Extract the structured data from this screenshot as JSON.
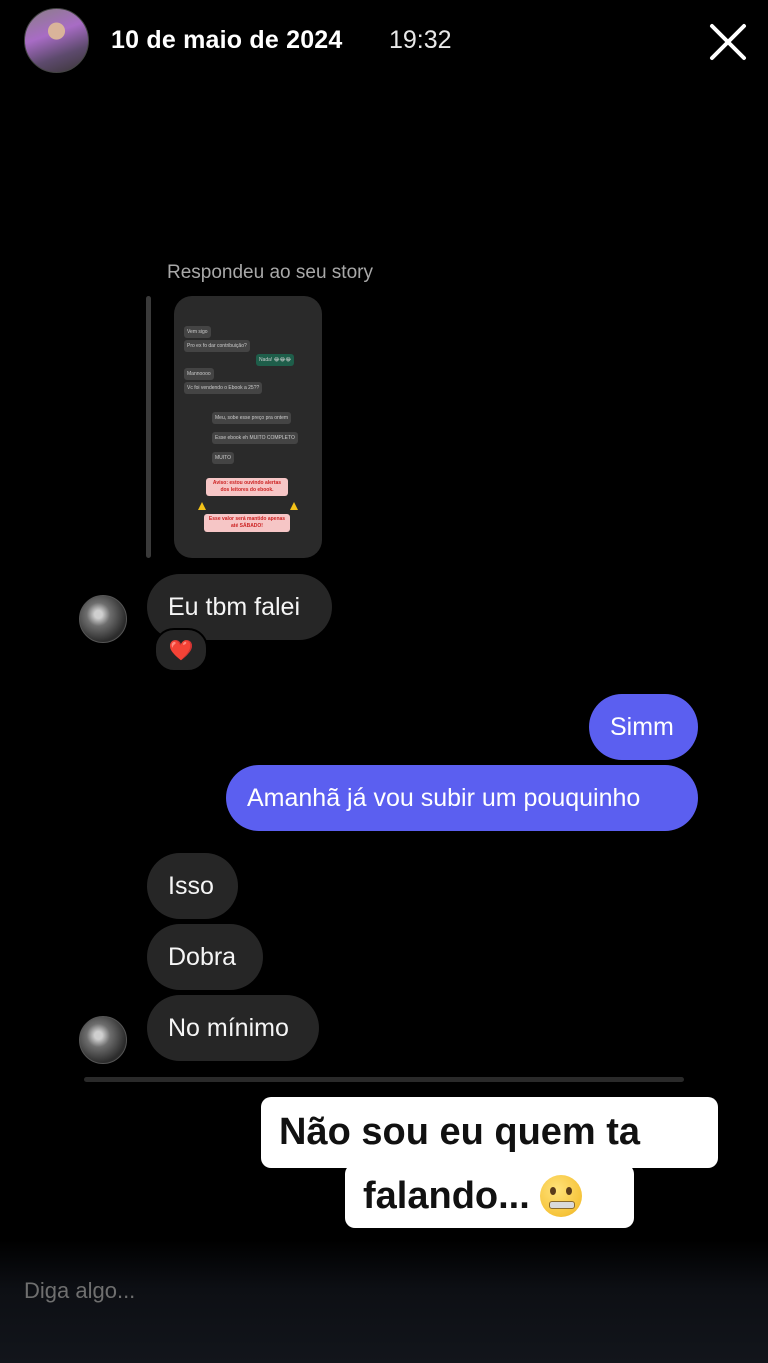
{
  "header": {
    "date": "10 de maio de 2024",
    "time": "19:32",
    "close_icon": "close-icon"
  },
  "story_reply": {
    "label": "Respondeu ao seu story",
    "thumbnail_lines": [
      "Vem sigo",
      "Pro ex fo dar contribuição?",
      "Nada! 😂😂😂",
      "Mannoooo",
      "Vc foi vendendo o Ebook a 25??",
      "Meu, sobe esse preço pra ontem",
      "Esse ebook eh MUITO COMPLETO",
      "MUITO",
      "Aviso: estou ouvindo alertas dos leitores do ebook.",
      "Esse valor será mantido apenas até SÁBADO!"
    ]
  },
  "messages": {
    "m1": "Eu tbm falei",
    "m1_reaction": "❤️",
    "m2": "Simm",
    "m3": "Amanhã já vou subir um pouquinho",
    "m4": "Isso",
    "m5": "Dobra",
    "m6": "No mínimo"
  },
  "sticker": {
    "line1": "Não sou eu quem ta",
    "line2": "falando..."
  },
  "composer": {
    "placeholder": "Diga algo..."
  },
  "colors": {
    "incoming_bubble": "#262626",
    "outgoing_bubble": "#5b5ff0",
    "background": "#000000"
  }
}
